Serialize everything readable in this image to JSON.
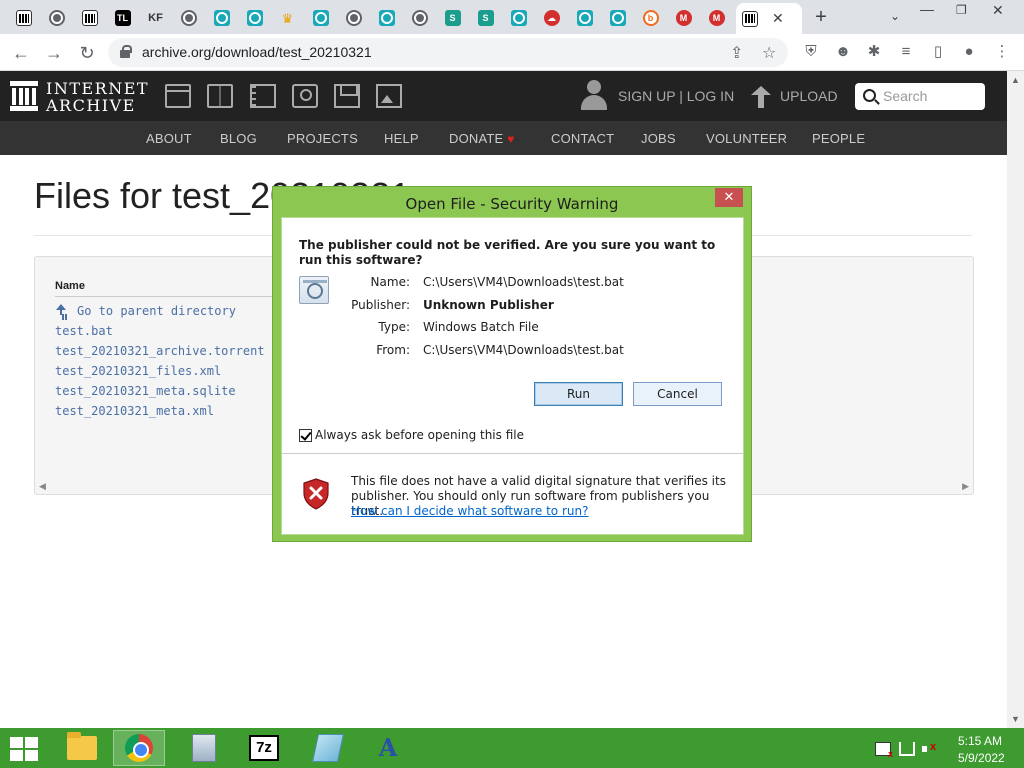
{
  "browser": {
    "url": "archive.org/download/test_20210321",
    "tab_favicons": [
      "internet-archive",
      "globe",
      "internet-archive",
      "tl",
      "kf",
      "globe",
      "teal-target",
      "teal-target",
      "crown",
      "teal-target",
      "globe",
      "teal-target",
      "globe",
      "teal-s",
      "teal-s",
      "teal-target",
      "red-cloud",
      "teal-target",
      "teal-target",
      "orange-b",
      "red-m",
      "red-m"
    ],
    "active_tab_favicon": "internet-archive",
    "tl_label": "TL",
    "kf_label": "KF"
  },
  "ia_header": {
    "logo_line1": "INTERNET",
    "logo_line2": "ARCHIVE",
    "sign_in": "SIGN UP | LOG IN",
    "upload": "UPLOAD",
    "search_placeholder": "Search",
    "nav": [
      "ABOUT",
      "BLOG",
      "PROJECTS",
      "HELP",
      "DONATE",
      "CONTACT",
      "JOBS",
      "VOLUNTEER",
      "PEOPLE"
    ]
  },
  "page": {
    "title": "Files for test_20210321",
    "column_name": "Name",
    "parent_dir": "Go to parent directory",
    "files": [
      "test.bat",
      "test_20210321_archive.torrent",
      "test_20210321_files.xml",
      "test_20210321_meta.sqlite",
      "test_20210321_meta.xml"
    ]
  },
  "dialog": {
    "title": "Open File - Security Warning",
    "question": "The publisher could not be verified.  Are you sure you want to run this software?",
    "fields": [
      {
        "label": "Name:",
        "value": "C:\\Users\\VM4\\Downloads\\test.bat"
      },
      {
        "label": "Publisher:",
        "value": "Unknown Publisher"
      },
      {
        "label": "Type:",
        "value": "Windows Batch File"
      },
      {
        "label": "From:",
        "value": "C:\\Users\\VM4\\Downloads\\test.bat"
      }
    ],
    "run_label": "Run",
    "cancel_label": "Cancel",
    "checkbox_label": "Always ask before opening this file",
    "checkbox_checked": true,
    "footer_text": "This file does not have a valid digital signature that verifies its publisher.  You should only run software from publishers you trust.",
    "footer_link": "How can I decide what software to run?"
  },
  "taskbar": {
    "time": "5:15 AM",
    "date": "5/9/2022",
    "seven_zip_label": "7z",
    "accent_color": "#3d9b2f"
  },
  "colors": {
    "dialog_frame": "#8cc751",
    "ia_header": "#222222",
    "ia_nav": "#333333",
    "link": "#4a6fa5",
    "heart": "#e02020"
  }
}
